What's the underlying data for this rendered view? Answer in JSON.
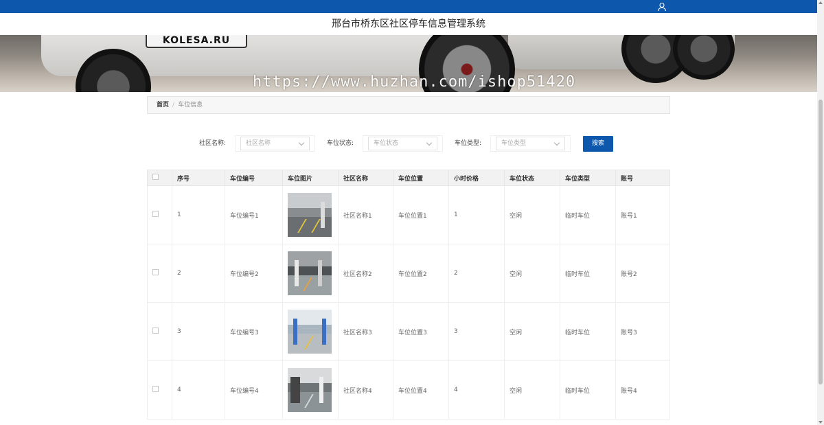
{
  "header": {
    "system_title": "邢台市桥东区社区停车信息管理系统",
    "user_icon": "user-icon"
  },
  "banner": {
    "plate_text": "KOLESA.RU",
    "watermark": "https://www.huzhan.com/ishop51420"
  },
  "breadcrumb": {
    "home": "首页",
    "separator": "/",
    "current": "车位信息"
  },
  "filters": {
    "community_label": "社区名称:",
    "community_placeholder": "社区名称",
    "status_label": "车位状态:",
    "status_placeholder": "车位状态",
    "type_label": "车位类型:",
    "type_placeholder": "车位类型",
    "search_button": "搜索"
  },
  "table": {
    "headers": [
      "序号",
      "车位编号",
      "车位图片",
      "社区名称",
      "车位位置",
      "小时价格",
      "车位状态",
      "车位类型",
      "账号"
    ],
    "rows": [
      {
        "index": "1",
        "code": "车位编号1",
        "community": "社区名称1",
        "location": "车位位置1",
        "price": "1",
        "status": "空闲",
        "type": "临时车位",
        "account": "账号1"
      },
      {
        "index": "2",
        "code": "车位编号2",
        "community": "社区名称2",
        "location": "车位位置2",
        "price": "2",
        "status": "空闲",
        "type": "临时车位",
        "account": "账号2"
      },
      {
        "index": "3",
        "code": "车位编号3",
        "community": "社区名称3",
        "location": "车位位置3",
        "price": "3",
        "status": "空闲",
        "type": "临时车位",
        "account": "账号3"
      },
      {
        "index": "4",
        "code": "车位编号4",
        "community": "社区名称4",
        "location": "车位位置4",
        "price": "4",
        "status": "空闲",
        "type": "临时车位",
        "account": "账号4"
      }
    ]
  },
  "colors": {
    "primary": "#0d57ad",
    "header_bg": "#f2f2f2"
  }
}
